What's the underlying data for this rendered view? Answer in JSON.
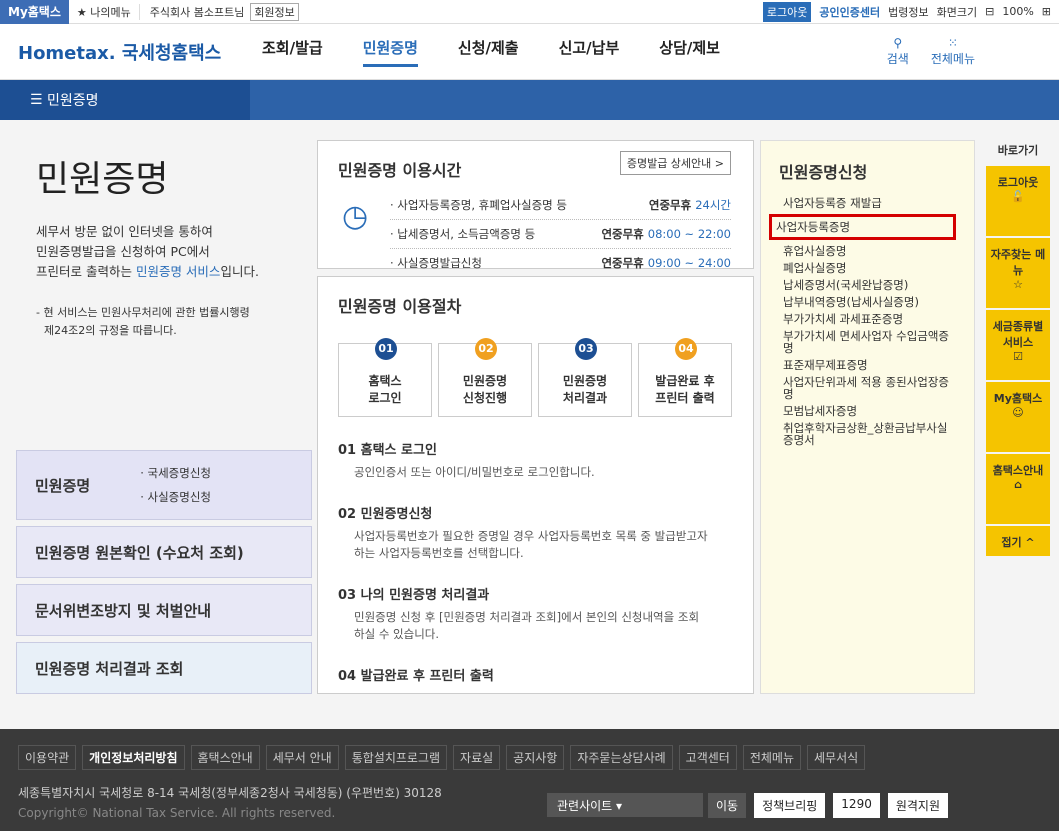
{
  "top": {
    "my": "My홈택스",
    "fav": "나의메뉴",
    "user": "주식회사 봄소프트님",
    "info": "회원정보",
    "logout": "로그아웃",
    "cert": "공인인증센터",
    "legal": "법령정보",
    "screen": "화면크기",
    "zoom": "100%"
  },
  "header": {
    "logo": "Hometax. 국세청홈택스",
    "nav": [
      "조회/발급",
      "민원증명",
      "신청/제출",
      "신고/납부",
      "상담/제보"
    ],
    "search": "검색",
    "all": "전체메뉴"
  },
  "crumb": "민원증명",
  "left": {
    "title": "민원증명",
    "desc1": "세무서 방문 없이 인터넷을 통하여",
    "desc2": "민원증명발급을 신청하여 PC에서",
    "desc3": "프린터로 출력하는 ",
    "desc3b": "민원증명 서비스",
    "desc3c": "입니다.",
    "note1": "- 현 서비스는 민원사무처리에 관한 법률시행령",
    "note2": "제24조2의 규정을 따릅니다.",
    "b1": "민원증명",
    "b1a": "· 국세증명신청",
    "b1b": "· 사실증명신청",
    "b2": "민원증명 원본확인 (수요처 조회)",
    "b3": "문서위변조방지 및 처벌안내",
    "b4": "민원증명 처리결과 조회"
  },
  "time": {
    "title": "민원증명 이용시간",
    "guide": "증명발급 상세안내 >",
    "rows": [
      {
        "l": "· 사업자등록증명, 휴폐업사실증명 등",
        "k": "연중무휴 ",
        "v": "24시간"
      },
      {
        "l": "· 납세증명서, 소득금액증명 등",
        "k": "연중무휴 ",
        "v": "08:00 ~ 22:00"
      },
      {
        "l": "· 사실증명발급신청",
        "k": "연중무휴 ",
        "v": "09:00 ~ 24:00"
      }
    ]
  },
  "proc": {
    "title": "민원증명 이용절차",
    "steps": [
      {
        "n": "01",
        "a": "홈택스",
        "b": "로그인"
      },
      {
        "n": "02",
        "a": "민원증명",
        "b": "신청진행"
      },
      {
        "n": "03",
        "a": "민원증명",
        "b": "처리결과"
      },
      {
        "n": "04",
        "a": "발급완료 후",
        "b": "프린터 출력"
      }
    ],
    "p": [
      {
        "t": "01 홈택스 로그인",
        "d1": "공인인증서 또는 아이디/비밀번호로 로그인합니다.",
        "d2": ""
      },
      {
        "t": "02 민원증명신청",
        "d1": "사업자등록번호가 필요한 증명일 경우 사업자등록번호 목록 중 발급받고자",
        "d2": "하는 사업자등록번호를 선택합니다."
      },
      {
        "t": "03 나의 민원증명 처리결과",
        "d1": "민원증명 신청 후 [민원증명 처리결과 조회]에서 본인의 신청내역을 조회",
        "d2": "하실 수 있습니다."
      },
      {
        "t": "04 발급완료 후 프린터 출력",
        "d1": "",
        "d2": ""
      }
    ]
  },
  "apply": {
    "title": "민원증명신청",
    "items": [
      "사업자등록증 재발급",
      "사업자등록증명",
      "휴업사실증명",
      "폐업사실증명",
      "납세증명서(국세완납증명)",
      "납부내역증명(납세사실증명)",
      "부가가치세 과세표준증명",
      "부가가치세 면세사업자 수입금액증명",
      "표준재무제표증명",
      "사업자단위과세 적용 종된사업장증명",
      "모범납세자증명",
      "취업후학자금상환_상환금납부사실증명서"
    ]
  },
  "quick": {
    "title": "바로가기",
    "items": [
      "로그아웃",
      "자주찾는 메뉴",
      "세금종류별 서비스",
      "My홈택스",
      "홈택스안내"
    ],
    "fold": "접기 ^"
  },
  "footer": {
    "links": [
      "이용약관",
      "개인정보처리방침",
      "홈택스안내",
      "세무서 안내",
      "통합설치프로그램",
      "자료실",
      "공지사항",
      "자주묻는상담사례",
      "고객센터",
      "전체메뉴",
      "세무서식"
    ],
    "addr": "세종특별자치시 국세청로 8-14 국세청(정부세종2청사 국세청동) (우편번호) 30128",
    "copy": "Copyright© National Tax Service. All rights reserved.",
    "site": "관련사이트",
    "go": "이동",
    "b1": "정책브리핑",
    "b2": "1290",
    "b3": "원격지원"
  }
}
